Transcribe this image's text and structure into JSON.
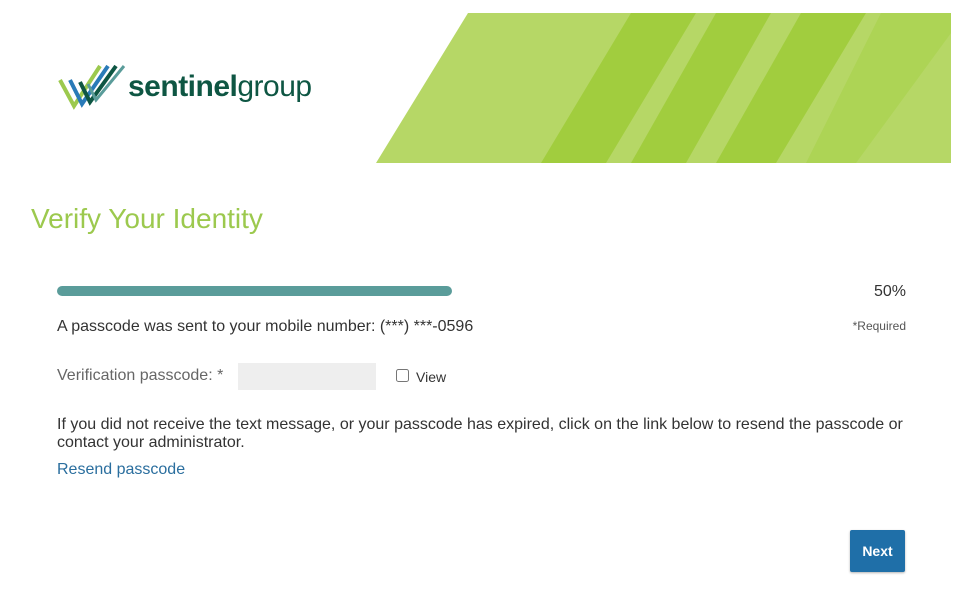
{
  "brand": {
    "name_strong": "sentinel",
    "name_light": "group",
    "colors": {
      "logo_text": "#0e5643",
      "banner_light": "#b6d766",
      "banner_stripe": "#a1cd3e",
      "title": "#9cc94e",
      "progress": "#5a9c9a",
      "button": "#1f6fa8",
      "link": "#2a6e9e"
    }
  },
  "page": {
    "title": "Verify Your Identity"
  },
  "progress": {
    "percent_label": "50%",
    "value": 0.5
  },
  "info": {
    "message": "A passcode was sent to your mobile number: (***) ***-0596",
    "required_note": "*Required"
  },
  "form": {
    "passcode_label": "Verification passcode: *",
    "passcode_value": "",
    "view_label": "View"
  },
  "help": {
    "text": "If you did not receive the text message, or your passcode has expired, click on the link below to resend the passcode or contact your administrator.",
    "resend_link": "Resend passcode"
  },
  "actions": {
    "next_label": "Next"
  }
}
